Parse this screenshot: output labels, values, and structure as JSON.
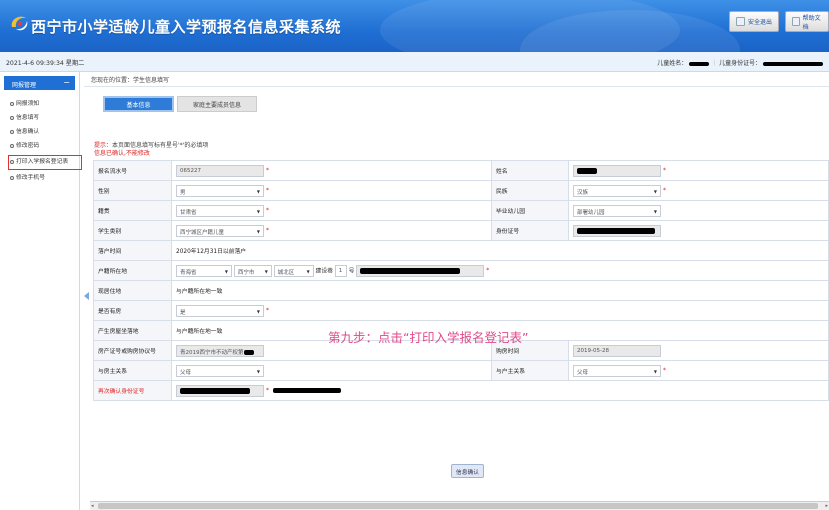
{
  "header": {
    "title": "西宁市小学适龄儿童入学预报名信息采集系统",
    "logout_label": "安全退出",
    "help_label": "帮助文档"
  },
  "infobar": {
    "datetime": "2021-4-6 09:39:34 星期二",
    "child_name_label": "儿童姓名：",
    "child_id_label": "儿童身份证号："
  },
  "sidebar": {
    "heading": "网报管理",
    "collapse_symbol": "−",
    "items": [
      {
        "label": "网报须知"
      },
      {
        "label": "信息填写"
      },
      {
        "label": "信息确认"
      },
      {
        "label": "修改密码"
      },
      {
        "label": "打印入学报名登记表"
      },
      {
        "label": "修改手机号"
      }
    ]
  },
  "breadcrumb": "您现在的位置：学生信息填写",
  "tabs": [
    {
      "label": "基本信息"
    },
    {
      "label": "家庭主要成员信息"
    }
  ],
  "tip": {
    "prefix": "提示：",
    "text": "本页面信息填写标有星号'*'的必填项",
    "confirmed": "信息已确认,不能修改"
  },
  "form": {
    "serial_label": "报名流水号",
    "serial_value": "065227",
    "name_label": "姓名",
    "gender_label": "性别",
    "gender_value": "男",
    "ethnicity_label": "民族",
    "ethnicity_value": "汉族",
    "native_label": "籍贯",
    "native_value": "甘肃省",
    "kindergarten_label": "毕业幼儿园",
    "kindergarten_value": "部署幼儿园",
    "student_type_label": "学生类别",
    "student_type_value": "西宁城区户籍儿童",
    "id_label": "身份证号",
    "hukou_time_label": "落户时间",
    "hukou_time_value": "2020年12月31日以前落户",
    "hukou_addr_label": "户籍所在地",
    "province_value": "青海省",
    "city_value": "西宁市",
    "district_value": "城北区",
    "street_value": "建设巷",
    "street_no": "1",
    "street_unit": "号",
    "residence_label": "现居住地",
    "residence_value": "与户籍所在地一致",
    "owns_house_label": "是否有房",
    "owns_house_value": "是",
    "property_loc_label": "产生房屋坐落地",
    "property_loc_value": "与户籍所在地一致",
    "cert_label": "房产证号或购房协议号",
    "cert_value": "青2019西宁市不动产权第",
    "purchase_time_label": "购房时间",
    "purchase_time_value": "2019-05-28",
    "relation_label": "与房主关系",
    "relation_value": "父母",
    "relation_label2": "与户主关系",
    "relation_value2": "父母",
    "reconfirm_label": "再次确认身份证号",
    "confirm_button": "信息确认"
  },
  "annotation": "第九步：点击“打印入学报名登记表”",
  "required_mark": "*",
  "colors": {
    "header_blue": "#1f6fd4",
    "annotation": "#e24a8a",
    "highlight": "#e03030"
  }
}
